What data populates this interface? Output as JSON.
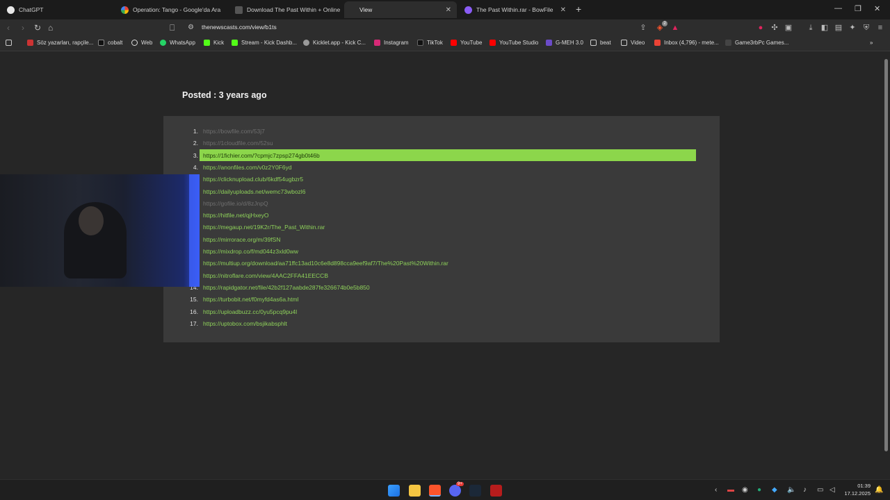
{
  "browser": {
    "tabs": [
      {
        "title": "ChatGPT",
        "active": false
      },
      {
        "title": "Operation: Tango - Google'da Ara",
        "active": false
      },
      {
        "title": "Download The Past Within + Online",
        "active": false
      },
      {
        "title": "View",
        "active": true
      },
      {
        "title": "The Past Within.rar - BowFile",
        "active": false
      }
    ],
    "url": "thenewscasts.com/view/b1ts",
    "bookmarks": [
      "Söz yazarları, rapçile...",
      "cobalt",
      "Web",
      "WhatsApp",
      "Kick",
      "Stream - Kick Dashb...",
      "Kicklet.app - Kick C...",
      "Instagram",
      "TikTok",
      "YouTube",
      "YouTube Studio",
      "G-MEH 3.0",
      "beat",
      "Video",
      "Inbox (4,796) - mete...",
      "Game3rbPc Games..."
    ],
    "shields_badge": "2"
  },
  "page": {
    "posted": "Posted : 3 years ago",
    "links": [
      {
        "num": "1.",
        "url": "https://bowfile.com/53j7",
        "state": "dim"
      },
      {
        "num": "2.",
        "url": "https://1cloudfile.com/52su",
        "state": "dim"
      },
      {
        "num": "3.",
        "url": "https://1fichier.com/?cpmjc7zpsp274gb0t46b",
        "state": "highlight"
      },
      {
        "num": "4.",
        "url": "https://anonfiles.com/v0z2Y0F6yd",
        "state": "normal"
      },
      {
        "num": "",
        "url": "https://clicknupload.club/6kdf54ugbzr5",
        "state": "normal"
      },
      {
        "num": "",
        "url": "https://dailyuploads.net/wemc73wbozl6",
        "state": "normal"
      },
      {
        "num": "",
        "url": "https://gofile.io/d/8zJnpQ",
        "state": "dim"
      },
      {
        "num": "",
        "url": "https://hitfile.net/qjHxeyO",
        "state": "normal"
      },
      {
        "num": "",
        "url": "https://megaup.net/19K2r/The_Past_Within.rar",
        "state": "normal"
      },
      {
        "num": "",
        "url": "https://mirrorace.org/m/39fSN",
        "state": "normal"
      },
      {
        "num": "",
        "url": "https://mixdrop.co/f/md044z3xld0ww",
        "state": "normal"
      },
      {
        "num": "",
        "url": "https://multiup.org/download/aa71ffc13ad10c6e8d898cca9eef9af7/The%20Past%20Within.rar",
        "state": "normal"
      },
      {
        "num": "",
        "url": "https://nitroflare.com/view/4AAC2FFA41EECCB",
        "state": "normal"
      },
      {
        "num": "14.",
        "url": "https://rapidgator.net/file/42b2f127aabde287fe326674b0e5b850",
        "state": "normal"
      },
      {
        "num": "15.",
        "url": "https://turbobit.net/f0myfd4as6a.html",
        "state": "normal"
      },
      {
        "num": "16.",
        "url": "https://uploadbuzz.cc/0yu5pcq9pu4l",
        "state": "normal"
      },
      {
        "num": "17.",
        "url": "https://uptobox.com/bsjikabsphlt",
        "state": "normal"
      }
    ]
  },
  "taskbar": {
    "time": "01:39",
    "date": "17.12.2025",
    "discord_badge": "9+"
  },
  "colors": {
    "link": "#8ed15a",
    "highlight": "#8cd64b",
    "card": "#3a3a3a",
    "page": "#262626"
  }
}
